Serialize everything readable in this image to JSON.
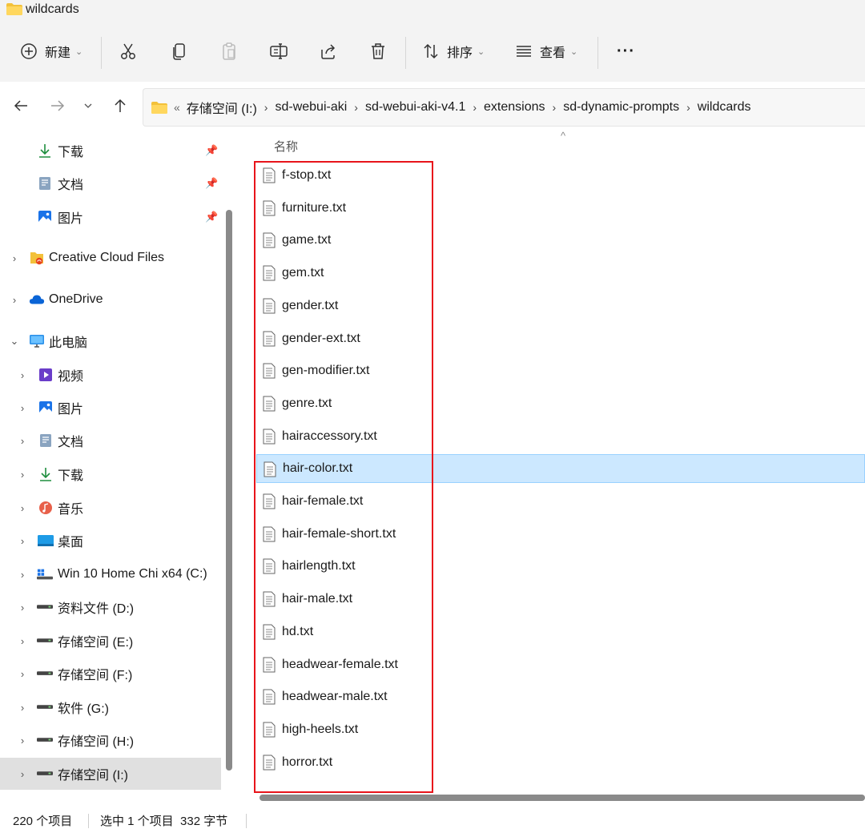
{
  "window": {
    "title": "wildcards",
    "folder_icon": "folder-icon"
  },
  "toolbar": {
    "new_label": "新建",
    "sort_label": "排序",
    "view_label": "查看",
    "more_label": "···"
  },
  "address": {
    "lead": "«",
    "crumbs": [
      "存储空间 (I:)",
      "sd-webui-aki",
      "sd-webui-aki-v4.1",
      "extensions",
      "sd-dynamic-prompts",
      "wildcards"
    ],
    "separator": "›"
  },
  "sidebar": {
    "quick_access": [
      {
        "label": "下载",
        "icon": "download-icon",
        "pinned": true
      },
      {
        "label": "文档",
        "icon": "documents-icon",
        "pinned": true
      },
      {
        "label": "图片",
        "icon": "pictures-icon",
        "pinned": true
      }
    ],
    "groups": [
      {
        "label": "Creative Cloud Files",
        "icon": "creative-cloud-folder-icon"
      },
      {
        "label": "OneDrive",
        "icon": "onedrive-cloud-icon"
      },
      {
        "label": "此电脑",
        "icon": "computer-icon"
      }
    ],
    "pc_items": [
      {
        "label": "视频",
        "icon": "videos-icon"
      },
      {
        "label": "图片",
        "icon": "pictures-icon"
      },
      {
        "label": "文档",
        "icon": "documents-icon"
      },
      {
        "label": "下载",
        "icon": "download-icon"
      },
      {
        "label": "音乐",
        "icon": "music-icon"
      },
      {
        "label": "桌面",
        "icon": "desktop-icon"
      },
      {
        "label": "Win 10 Home Chi x64 (C:)",
        "icon": "windows-drive-icon"
      },
      {
        "label": "资料文件 (D:)",
        "icon": "drive-icon"
      },
      {
        "label": "存储空间 (E:)",
        "icon": "drive-icon"
      },
      {
        "label": "存储空间 (F:)",
        "icon": "drive-icon"
      },
      {
        "label": "软件 (G:)",
        "icon": "drive-icon"
      },
      {
        "label": "存储空间 (H:)",
        "icon": "drive-icon"
      },
      {
        "label": "存储空间 (I:)",
        "icon": "drive-icon",
        "selected": true
      }
    ]
  },
  "list": {
    "column_name": "名称",
    "files": [
      "f-stop.txt",
      "furniture.txt",
      "game.txt",
      "gem.txt",
      "gender.txt",
      "gender-ext.txt",
      "gen-modifier.txt",
      "genre.txt",
      "hairaccessory.txt",
      "hair-color.txt",
      "hair-female.txt",
      "hair-female-short.txt",
      "hairlength.txt",
      "hair-male.txt",
      "hd.txt",
      "headwear-female.txt",
      "headwear-male.txt",
      "high-heels.txt",
      "horror.txt"
    ],
    "selected_file": "hair-color.txt"
  },
  "status": {
    "item_count": "220 个项目",
    "selection": "选中 1 个项目  332 字节"
  },
  "colors": {
    "selection_bg": "#cce8ff",
    "highlight_box": "#e8141b"
  }
}
